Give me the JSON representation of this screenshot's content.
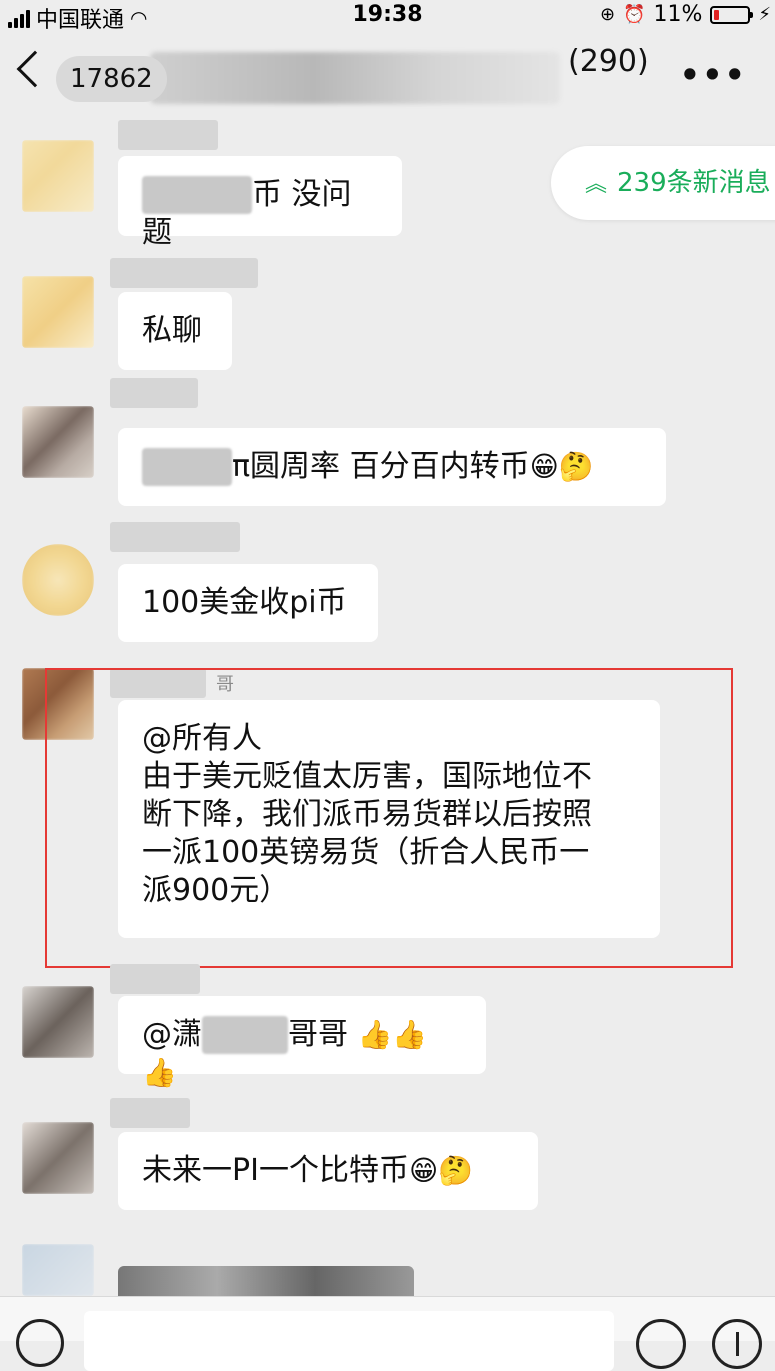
{
  "status_bar": {
    "carrier": "中国联通",
    "time": "19:38",
    "battery_percent": "11%",
    "battery_level": 0.11
  },
  "nav": {
    "title_prefix": "17862",
    "member_count": "(290)",
    "more_glyph": "•••"
  },
  "new_messages": {
    "label": "239条新消息",
    "chevron": "≈"
  },
  "messages": [
    {
      "text": "币 没问题"
    },
    {
      "text": "私聊"
    },
    {
      "text": "π圆周率 百分百内转币",
      "emoji": "😁🤔"
    },
    {
      "text": "100美金收pi币"
    },
    {
      "sender_tail": "哥",
      "lines": [
        "@所有人",
        "由于美元贬值太厉害，国际地位不",
        "断下降，我们派币易货群以后按照",
        "一派100英镑易货（折合人民币一",
        "派900元）"
      ]
    },
    {
      "prefix": "@潇",
      "text": "哥哥",
      "emoji": "👍👍👍"
    },
    {
      "text": "未来一PI一个比特币",
      "emoji": "😁🤔"
    }
  ],
  "colors": {
    "accent_green": "#1aad5a",
    "highlight_red": "#e53935",
    "chat_bg": "#ededed"
  }
}
